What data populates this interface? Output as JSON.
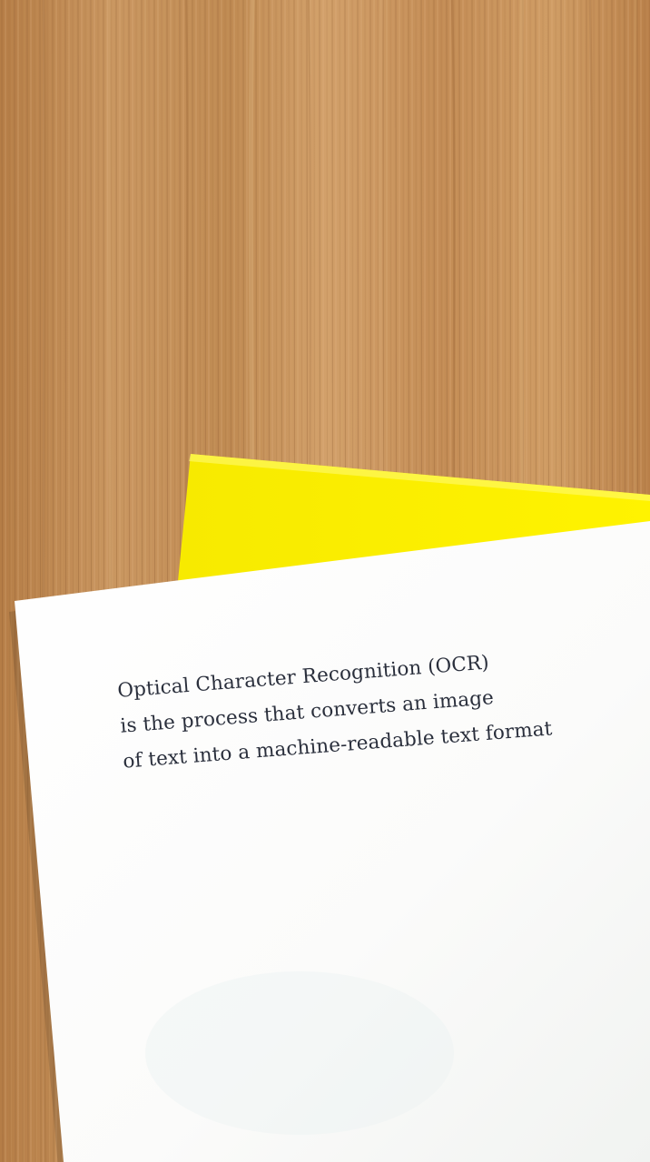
{
  "photo": {
    "subject": "printed sheet of paper on wooden desk",
    "colors": {
      "wood_base": "#c08a52",
      "wood_light": "#d4a26a",
      "wood_dark": "#9d6a3b",
      "sticky_note": "#fff100",
      "paper": "#fbfbfa",
      "ink": "#2a2f3c"
    },
    "paper_text": {
      "line1": "Optical Character Recognition (OCR)",
      "line2": "is the process that converts an image",
      "line3": "of text into a machine-readable text format"
    }
  }
}
